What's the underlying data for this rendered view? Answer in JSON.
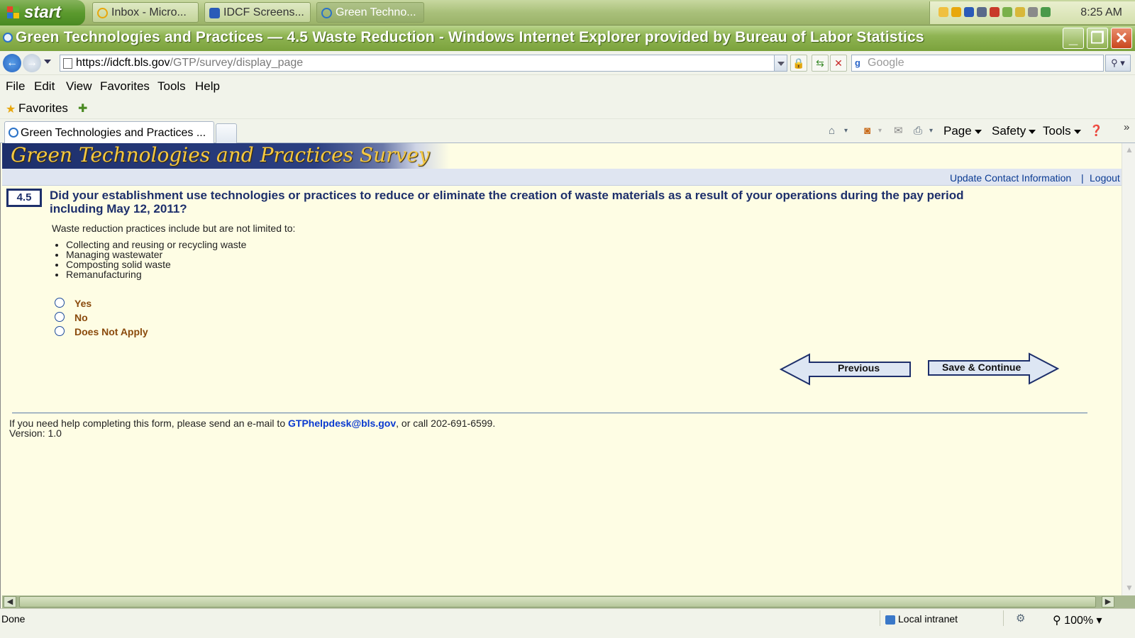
{
  "taskbar": {
    "start_label": "start",
    "buttons": [
      {
        "label": "Inbox - Micro..."
      },
      {
        "label": "IDCF Screens..."
      },
      {
        "label": "Green Techno..."
      }
    ],
    "clock": "8:25 AM"
  },
  "window": {
    "title": "Green Technologies and Practices — 4.5 Waste Reduction - Windows Internet Explorer provided by Bureau of Labor Statistics"
  },
  "address": {
    "url_host": "https://idcft.bls.gov",
    "url_path": "/GTP/survey/display_page",
    "search_placeholder": "Google"
  },
  "menu": [
    "File",
    "Edit",
    "View",
    "Favorites",
    "Tools",
    "Help"
  ],
  "favorites": {
    "label": "Favorites"
  },
  "tab": {
    "label": "Green Technologies and Practices ..."
  },
  "command_bar": {
    "page": "Page",
    "safety": "Safety",
    "tools": "Tools"
  },
  "page": {
    "banner_title": "Green Technologies and Practices Survey",
    "links": {
      "update_contact": "Update Contact Information",
      "separator": "|",
      "logout": "Logout"
    },
    "question": {
      "number": "4.5",
      "text": "Did your establishment use technologies or practices to reduce or eliminate the creation of waste materials as a result of your operations during the pay period including May 12, 2011?",
      "intro": "Waste reduction practices include but are not limited to:",
      "examples": [
        "Collecting and reusing or recycling waste",
        "Managing wastewater",
        "Composting solid waste",
        "Remanufacturing"
      ],
      "options": [
        "Yes",
        "No",
        "Does Not Apply"
      ]
    },
    "buttons": {
      "previous": "Previous",
      "save_continue": "Save & Continue"
    },
    "footer": {
      "help_prefix": "If you need help completing this form, please send an e-mail to ",
      "email": "GTPhelpdesk@bls.gov",
      "help_suffix": ", or call 202-691-6599.",
      "version": "Version: 1.0"
    }
  },
  "status": {
    "done": "Done",
    "zone": "Local intranet",
    "zoom": "100%"
  }
}
